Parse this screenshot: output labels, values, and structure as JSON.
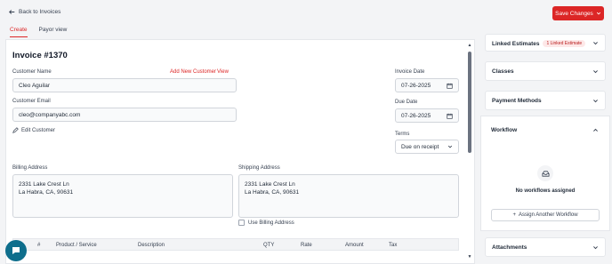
{
  "header": {
    "back_label": "Back to Invoices",
    "save_label": "Save Changes"
  },
  "tabs": [
    {
      "label": "Create",
      "active": true
    },
    {
      "label": "Payor view",
      "active": false
    }
  ],
  "invoice": {
    "title": "Invoice #1370",
    "customer_name_label": "Customer Name",
    "add_new_customer": "Add New Customer",
    "view": "View",
    "customer_name": "Cleo Aguilar",
    "customer_email_label": "Customer Email",
    "customer_email": "cleo@companyabc.com",
    "edit_customer": "Edit Customer",
    "invoice_date_label": "Invoice Date",
    "invoice_date": "07-26-2025",
    "due_date_label": "Due Date",
    "due_date": "07-26-2025",
    "terms_label": "Terms",
    "terms": "Due on receipt",
    "billing_label": "Billing Address",
    "billing_line1": "2331 Lake Crest Ln",
    "billing_line2": "La Habra, CA, 90631",
    "shipping_label": "Shipping Address",
    "shipping_line1": "2331 Lake Crest Ln",
    "shipping_line2": "La Habra, CA, 90631",
    "use_billing": "Use Billing Address"
  },
  "table": {
    "columns": [
      "#",
      "Product / Service",
      "Description",
      "QTY",
      "Rate",
      "Amount",
      "Tax"
    ]
  },
  "side_panels": {
    "linked_estimates": "Linked Estimates",
    "linked_badge": "1 Linked Estimate",
    "classes": "Classes",
    "payment_methods": "Payment Methods",
    "workflow": "Workflow",
    "no_workflows": "No workflows assigned",
    "assign_workflow": "Assign Another Workflow",
    "attachments": "Attachments"
  },
  "colors": {
    "accent": "#dc2626",
    "chat_button": "#0e6e8c"
  }
}
